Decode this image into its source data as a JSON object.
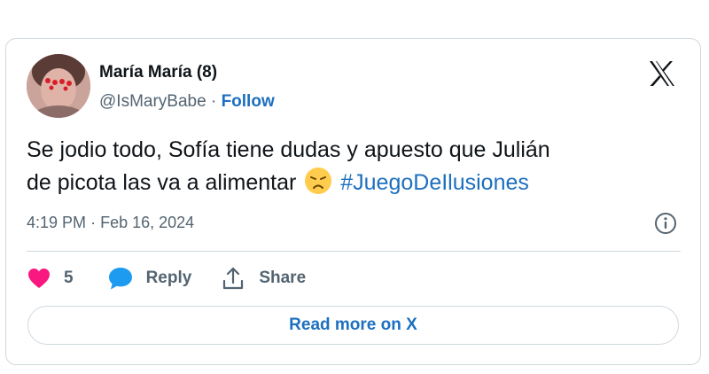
{
  "author": {
    "name": "María María (8)",
    "handle": "@IsMaryBabe",
    "separator": "·",
    "follow_label": "Follow"
  },
  "tweet": {
    "text_line1": "Se jodio todo, Sofía tiene dudas y apuesto que Julián",
    "text_line2": "de picota las va a alimentar",
    "emoji": "disappointed-face-emoji",
    "hashtag": "#JuegoDeIlusiones"
  },
  "meta": {
    "time": "4:19 PM",
    "separator": "·",
    "date": "Feb 16, 2024"
  },
  "actions": {
    "like_count": "5",
    "reply_label": "Reply",
    "share_label": "Share"
  },
  "read_more_label": "Read more on X",
  "icons": {
    "logo": "x-logo-icon",
    "info": "info-icon",
    "like": "heart-icon",
    "reply": "speech-bubble-icon",
    "share": "share-upload-icon"
  },
  "colors": {
    "link_blue": "#1d6fbf",
    "heart": "#f91880",
    "reply_bubble": "#1d9bf0",
    "muted_text": "#536471",
    "border": "#cfd9de"
  }
}
